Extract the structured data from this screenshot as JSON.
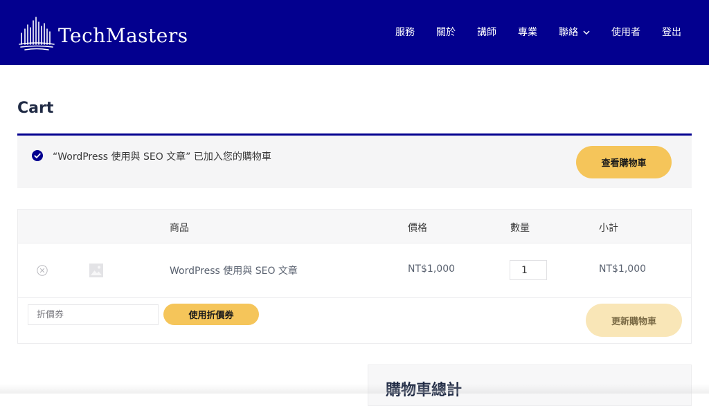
{
  "header": {
    "brand": "TechMasters",
    "nav": [
      {
        "label": "服務"
      },
      {
        "label": "關於"
      },
      {
        "label": "講師"
      },
      {
        "label": "專業"
      },
      {
        "label": "聯絡",
        "has_dropdown": true
      },
      {
        "label": "使用者"
      },
      {
        "label": "登出"
      }
    ],
    "bg_color": "#03008f"
  },
  "page": {
    "title": "Cart"
  },
  "notice": {
    "icon": "check-circle-icon",
    "message": "“WordPress 使用與 SEO 文章” 已加入您的購物車",
    "view_cart_label": "查看購物車"
  },
  "cart": {
    "columns": [
      "商品",
      "價格",
      "數量",
      "小計"
    ],
    "items": [
      {
        "remove_icon": "remove-circle-icon",
        "thumbnail_icon": "image-placeholder-icon",
        "product": "WordPress 使用與 SEO 文章",
        "price": "NT$1,000",
        "quantity": "1",
        "subtotal": "NT$1,000"
      }
    ],
    "coupon_placeholder": "折價券",
    "apply_coupon_label": "使用折價券",
    "update_cart_label": "更新購物車"
  },
  "totals": {
    "title": "購物車總計"
  },
  "colors": {
    "accent": "#f5c55a",
    "brand": "#03008f"
  }
}
